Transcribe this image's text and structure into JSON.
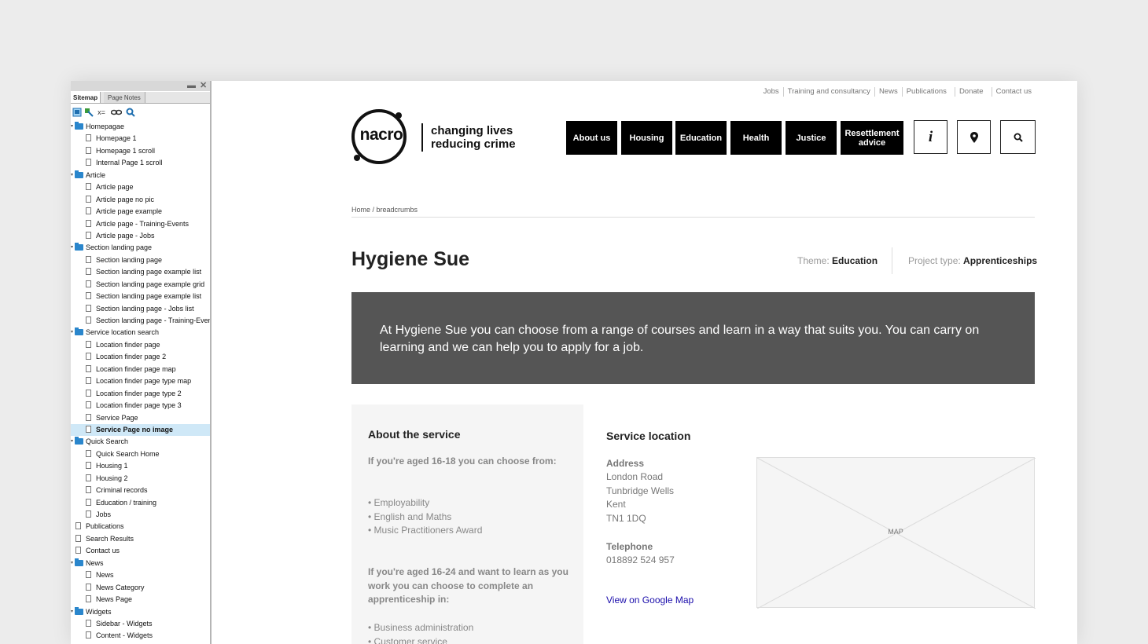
{
  "sitemap": {
    "tabs": [
      "Sitemap",
      "Page Notes"
    ],
    "controls": {
      "minimize": "▬",
      "close": "✕"
    },
    "toolbar": [
      "add-page-icon",
      "add-child-icon",
      "x=",
      "link-icon",
      "search-icon"
    ],
    "tree": [
      {
        "label": "Homepagae",
        "type": "folder",
        "level": 0
      },
      {
        "label": "Homepage 1",
        "type": "page",
        "level": 1
      },
      {
        "label": "Homepage 1 scroll",
        "type": "page",
        "level": 1
      },
      {
        "label": "Internal Page 1 scroll",
        "type": "page",
        "level": 1
      },
      {
        "label": "Article",
        "type": "folder",
        "level": 0
      },
      {
        "label": "Article page",
        "type": "page",
        "level": 1
      },
      {
        "label": "Article page no pic",
        "type": "page",
        "level": 1
      },
      {
        "label": "Article page example",
        "type": "page",
        "level": 1
      },
      {
        "label": "Article page - Training-Events",
        "type": "page",
        "level": 1
      },
      {
        "label": "Article page - Jobs",
        "type": "page",
        "level": 1
      },
      {
        "label": "Section landing page",
        "type": "folder",
        "level": 0
      },
      {
        "label": "Section landing page",
        "type": "page",
        "level": 1
      },
      {
        "label": "Section landing page example list",
        "type": "page",
        "level": 1
      },
      {
        "label": "Section landing page example grid",
        "type": "page",
        "level": 1
      },
      {
        "label": "Section landing page example list",
        "type": "page",
        "level": 1
      },
      {
        "label": "Section landing page - Jobs list",
        "type": "page",
        "level": 1
      },
      {
        "label": "Section landing page - Training-Event",
        "type": "page",
        "level": 1
      },
      {
        "label": "Service location search",
        "type": "folder",
        "level": 0
      },
      {
        "label": "Location finder page",
        "type": "page",
        "level": 1
      },
      {
        "label": "Location finder page 2",
        "type": "page",
        "level": 1
      },
      {
        "label": "Location finder page map",
        "type": "page",
        "level": 1
      },
      {
        "label": "Location finder page type map",
        "type": "page",
        "level": 1
      },
      {
        "label": "Location finder page type 2",
        "type": "page",
        "level": 1
      },
      {
        "label": "Location finder page type 3",
        "type": "page",
        "level": 1
      },
      {
        "label": "Service Page",
        "type": "page",
        "level": 1
      },
      {
        "label": "Service Page no image",
        "type": "page",
        "level": 1,
        "selected": true
      },
      {
        "label": "Quick Search",
        "type": "folder",
        "level": 0
      },
      {
        "label": "Quick Search Home",
        "type": "page",
        "level": 1
      },
      {
        "label": "Housing 1",
        "type": "page",
        "level": 1
      },
      {
        "label": "Housing 2",
        "type": "page",
        "level": 1
      },
      {
        "label": "Criminal records",
        "type": "page",
        "level": 1
      },
      {
        "label": "Education / training",
        "type": "page",
        "level": 1
      },
      {
        "label": "Jobs",
        "type": "page",
        "level": 1
      },
      {
        "label": "Publications",
        "type": "page",
        "level": 0
      },
      {
        "label": "Search Results",
        "type": "page",
        "level": 0
      },
      {
        "label": "Contact us",
        "type": "page",
        "level": 0
      },
      {
        "label": "News",
        "type": "folder",
        "level": 0
      },
      {
        "label": "News",
        "type": "page",
        "level": 1
      },
      {
        "label": "News Category",
        "type": "page",
        "level": 1
      },
      {
        "label": "News Page",
        "type": "page",
        "level": 1
      },
      {
        "label": "Widgets",
        "type": "folder",
        "level": 0
      },
      {
        "label": "Sidebar - Widgets",
        "type": "page",
        "level": 1
      },
      {
        "label": "Content - Widgets",
        "type": "page",
        "level": 1
      }
    ]
  },
  "site": {
    "toplinks": [
      "Jobs",
      "Training and consultancy",
      "News",
      "Publications",
      "Donate",
      "Contact us"
    ],
    "logo": {
      "word": "nacro",
      "line1": "changing lives",
      "line2": "reducing crime"
    },
    "nav": [
      "About us",
      "Housing",
      "Education",
      "Health",
      "Justice",
      "Resettlement advice"
    ],
    "icons": {
      "info": "i"
    },
    "breadcrumb": "Home / breadcrumbs",
    "title": "Hygiene Sue",
    "theme_label": "Theme:",
    "theme_value": "Education",
    "project_label": "Project type:",
    "project_value": "Apprenticeships",
    "banner": "At Hygiene Sue you can choose from a range of courses and learn in a way that suits you. You can carry on learning and we can help you to apply for a job.",
    "about": {
      "heading": "About the service",
      "q1": "If you're aged 16-18 you can choose from:",
      "list1": [
        "• Employability",
        "• English and Maths",
        "• Music Practitioners Award"
      ],
      "q2": "If you're aged 16-24 and want to learn as you work you can choose to complete an apprenticeship in:",
      "list2": [
        "• Business administration",
        "• Customer service"
      ]
    },
    "location": {
      "heading": "Service location",
      "address_label": "Address",
      "address": [
        "London Road",
        "Tunbridge Wells",
        "Kent",
        "TN1 1DQ"
      ],
      "telephone_label": "Telephone",
      "telephone": "018892 524 957",
      "map_link": "View on Google Map",
      "map_placeholder": "MAP"
    }
  }
}
